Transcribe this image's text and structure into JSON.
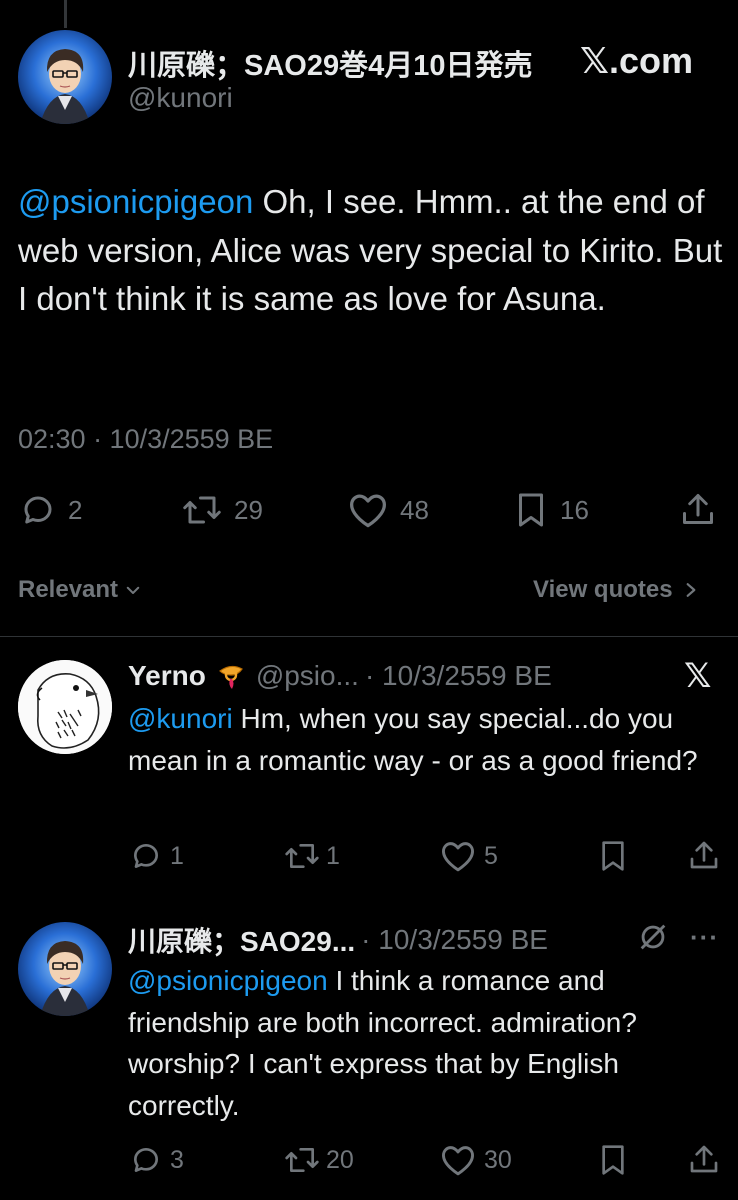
{
  "main_tweet": {
    "author_name": "川原礫；SAO29巻4月10日発売",
    "author_handle": "@kunori",
    "site_logo": "𝕏.com",
    "mention": "@psionicpigeon",
    "text": " Oh, I see. Hmm.. at the end of web version, Alice was very special to Kirito. But I don't think it is same as love for Asuna.",
    "timestamp": "02:30 · 10/3/2559 BE",
    "stats": {
      "replies": "2",
      "retweets": "29",
      "likes": "48",
      "bookmarks": "16"
    }
  },
  "sort_bar": {
    "relevant_label": "Relevant",
    "view_quotes_label": "View quotes"
  },
  "replies": [
    {
      "author_name": "Yerno",
      "author_handle": "@psio...",
      "date": "· 10/3/2559 BE",
      "logo": "𝕏",
      "mention": "@kunori",
      "text": " Hm, when you say special...do you mean in a romantic way - or as a good friend?",
      "stats": {
        "replies": "1",
        "retweets": "1",
        "likes": "5"
      }
    },
    {
      "author_name": "川原礫；SAO29...",
      "date": "· 10/3/2559 BE",
      "mention": "@psionicpigeon",
      "text": " I think a romance and friendship are both incorrect. admiration? worship? I can't express that by English correctly.",
      "stats": {
        "replies": "3",
        "retweets": "20",
        "likes": "30"
      }
    }
  ],
  "icons": [
    "reply-icon",
    "retweet-icon",
    "like-icon",
    "bookmark-icon",
    "share-icon",
    "chevron-down-icon",
    "chevron-right-icon",
    "x-logo-icon",
    "horn-emoji-icon",
    "more-icon",
    "translate-icon"
  ],
  "colors": {
    "background": "#000000",
    "text": "#e7e9ea",
    "muted": "#71767b",
    "link": "#1d9bf0"
  }
}
